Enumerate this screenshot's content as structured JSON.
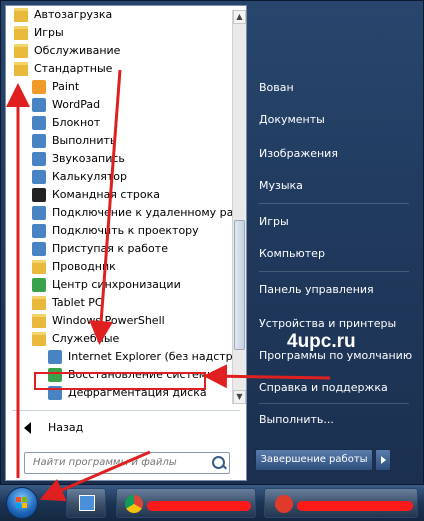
{
  "programs": [
    {
      "label": "Автозагрузка",
      "icon": "folder-icon",
      "kind": "folder",
      "indent": 0
    },
    {
      "label": "Игры",
      "icon": "folder-icon",
      "kind": "folder",
      "indent": 0
    },
    {
      "label": "Обслуживание",
      "icon": "folder-icon",
      "kind": "folder",
      "indent": 0
    },
    {
      "label": "Стандартные",
      "icon": "folder-icon",
      "kind": "folder",
      "indent": 0
    },
    {
      "label": "Paint",
      "icon": "paint-icon",
      "kind": "app",
      "indent": 1
    },
    {
      "label": "WordPad",
      "icon": "wordpad-icon",
      "kind": "app",
      "indent": 1
    },
    {
      "label": "Блокнот",
      "icon": "notepad-icon",
      "kind": "app",
      "indent": 1
    },
    {
      "label": "Выполнить",
      "icon": "run-icon",
      "kind": "app",
      "indent": 1
    },
    {
      "label": "Звукозапись",
      "icon": "microphone-icon",
      "kind": "app",
      "indent": 1
    },
    {
      "label": "Калькулятор",
      "icon": "calculator-icon",
      "kind": "app",
      "indent": 1
    },
    {
      "label": "Командная строка",
      "icon": "command-prompt-icon",
      "kind": "app",
      "indent": 1
    },
    {
      "label": "Подключение к удаленному рабо",
      "icon": "remote-desktop-icon",
      "kind": "app",
      "indent": 1
    },
    {
      "label": "Подключить к проектору",
      "icon": "projector-icon",
      "kind": "app",
      "indent": 1
    },
    {
      "label": "Приступая к работе",
      "icon": "getting-started-icon",
      "kind": "app",
      "indent": 1
    },
    {
      "label": "Проводник",
      "icon": "explorer-icon",
      "kind": "app",
      "indent": 1
    },
    {
      "label": "Центр синхронизации",
      "icon": "sync-center-icon",
      "kind": "app",
      "indent": 1
    },
    {
      "label": "Tablet PC",
      "icon": "folder-icon",
      "kind": "folder",
      "indent": 1
    },
    {
      "label": "Windows PowerShell",
      "icon": "folder-icon",
      "kind": "folder",
      "indent": 1
    },
    {
      "label": "Служебные",
      "icon": "folder-icon",
      "kind": "folder",
      "indent": 1
    },
    {
      "label": "Internet Explorer (без надстроек",
      "icon": "internet-explorer-icon",
      "kind": "app",
      "indent": 2
    },
    {
      "label": "Восстановление системы",
      "icon": "system-restore-icon",
      "kind": "app",
      "indent": 2
    },
    {
      "label": "Дефрагментация диска",
      "icon": "defrag-icon",
      "kind": "app",
      "indent": 2
    }
  ],
  "back_label": "Назад",
  "search": {
    "placeholder": "Найти программы и файлы"
  },
  "right_items": [
    {
      "label": "Вован"
    },
    {
      "label": "Документы"
    },
    {
      "label": "Изображения"
    },
    {
      "label": "Музыка"
    },
    {
      "label": "Игры"
    },
    {
      "label": "Компьютер"
    },
    {
      "label": "Панель управления"
    },
    {
      "label": "Устройства и принтеры"
    },
    {
      "label": "Программы по умолчанию"
    },
    {
      "label": "Справка и поддержка"
    },
    {
      "label": "Выполнить..."
    }
  ],
  "shutdown_label": "Завершение работы",
  "watermark": "4upc.ru",
  "colors": {
    "annotation_red": "#e02020",
    "folder": "#e8b93a",
    "menu_right": "#203a5e"
  }
}
